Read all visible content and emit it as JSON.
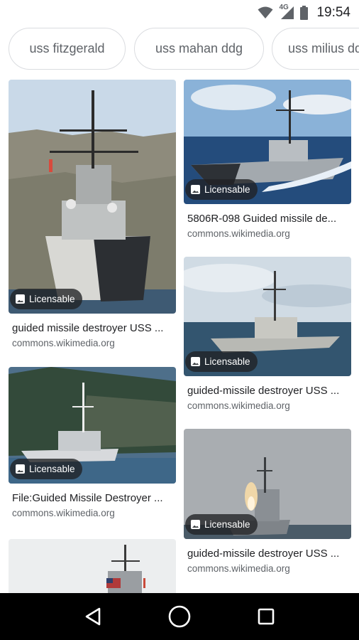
{
  "status_bar": {
    "time": "19:54",
    "network": "4G",
    "icons": [
      "wifi-icon",
      "cell-signal-icon",
      "battery-icon"
    ]
  },
  "chips": [
    {
      "label": "uss fitzgerald"
    },
    {
      "label": "uss mahan ddg"
    },
    {
      "label": "uss milius ddg"
    }
  ],
  "results": [
    {
      "caption": "guided missile destroyer USS ...",
      "source": "commons.wikimedia.org",
      "badge": "Licensable"
    },
    {
      "caption": "5806R-098 Guided missile de...",
      "source": "commons.wikimedia.org",
      "badge": "Licensable"
    },
    {
      "caption": "guided-missile destroyer USS ...",
      "source": "commons.wikimedia.org",
      "badge": "Licensable"
    },
    {
      "caption": "File:Guided Missile Destroyer ...",
      "source": "commons.wikimedia.org",
      "badge": "Licensable"
    },
    {
      "caption": "guided-missile destroyer USS ...",
      "source": "commons.wikimedia.org",
      "badge": "Licensable"
    }
  ],
  "nav_bar": {
    "icons": [
      "back-triangle-icon",
      "home-circle-icon",
      "recents-square-icon"
    ]
  }
}
